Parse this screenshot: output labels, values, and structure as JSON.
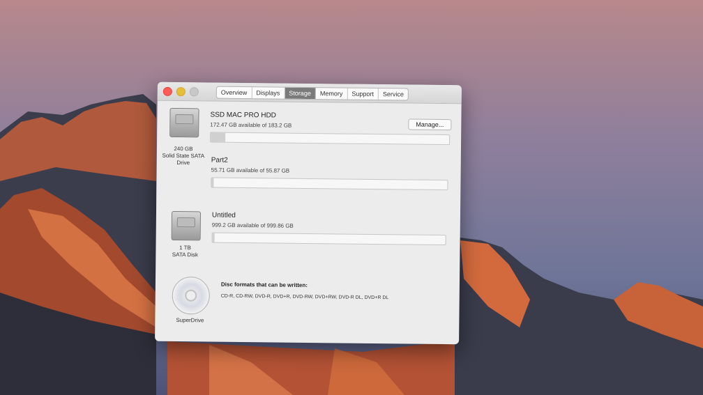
{
  "window": {
    "tabs": [
      {
        "label": "Overview"
      },
      {
        "label": "Displays"
      },
      {
        "label": "Storage",
        "active": true
      },
      {
        "label": "Memory"
      },
      {
        "label": "Support"
      },
      {
        "label": "Service"
      }
    ],
    "manage_label": "Manage..."
  },
  "drives": [
    {
      "icon": "hard-drive-icon",
      "label_line1": "240 GB",
      "label_line2": "Solid State SATA",
      "label_line3": "Drive",
      "volumes": [
        {
          "name": "SSD MAC PRO HDD",
          "available": "172.47 GB available of 183.2 GB",
          "used_fraction": 0.06
        },
        {
          "name": "Part2",
          "available": "55.71 GB available of 55.87 GB",
          "used_fraction": 0.01
        }
      ]
    },
    {
      "icon": "hard-drive-icon",
      "label_line1": "1 TB",
      "label_line2": "SATA Disk",
      "volumes": [
        {
          "name": "Untitled",
          "available": "999.2 GB available of 999.86 GB",
          "used_fraction": 0.01
        }
      ]
    }
  ],
  "superdrive": {
    "icon": "disc-icon",
    "label": "SuperDrive",
    "title": "Disc formats that can be written:",
    "formats": "CD-R, CD-RW, DVD-R, DVD+R, DVD-RW, DVD+RW, DVD-R DL, DVD+R DL"
  },
  "colors": {
    "close": "#fc5b57",
    "minimize": "#e5bf3c",
    "active_tab": "#7a7a7a"
  }
}
